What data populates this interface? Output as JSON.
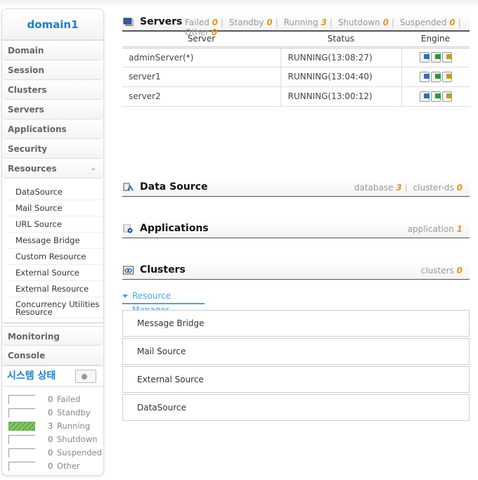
{
  "sidebar": {
    "domain": "domain1",
    "nav": [
      "Domain",
      "Session",
      "Clusters",
      "Servers",
      "Applications",
      "Security",
      "Resources"
    ],
    "resources_sub": [
      "DataSource",
      "Mail Source",
      "URL Source",
      "Message Bridge",
      "Custom Resource",
      "External Source",
      "External Resource",
      "Concurrency Utilities Resource"
    ],
    "nav_bottom": [
      "Monitoring",
      "Console"
    ],
    "system_status": {
      "title": "시스템 상태",
      "rows": [
        {
          "count": "0",
          "label": "Failed",
          "active": false
        },
        {
          "count": "0",
          "label": "Standby",
          "active": false
        },
        {
          "count": "3",
          "label": "Running",
          "active": true
        },
        {
          "count": "0",
          "label": "Shutdown",
          "active": false
        },
        {
          "count": "0",
          "label": "Suspended",
          "active": false
        },
        {
          "count": "0",
          "label": "Other",
          "active": false
        }
      ]
    }
  },
  "servers": {
    "title": "Servers",
    "counts": [
      {
        "label": "Failed",
        "value": "0"
      },
      {
        "label": "Standby",
        "value": "0"
      },
      {
        "label": "Running",
        "value": "3"
      },
      {
        "label": "Shutdown",
        "value": "0"
      },
      {
        "label": "Suspended",
        "value": "0"
      },
      {
        "label": "Other",
        "value": "0"
      }
    ],
    "columns": [
      "Server",
      "Status",
      "Engine"
    ],
    "rows": [
      {
        "server": "adminServer(*)",
        "status": "RUNNING(13:08:27)"
      },
      {
        "server": "server1",
        "status": "RUNNING(13:04:40)"
      },
      {
        "server": "server2",
        "status": "RUNNING(13:00:12)"
      }
    ],
    "engine_icons": [
      "web-engine-icon",
      "jsp-engine-icon",
      "ejb-engine-icon"
    ]
  },
  "datasource": {
    "title": "Data Source",
    "counts": [
      {
        "label": "database",
        "value": "3"
      },
      {
        "label": "cluster-ds",
        "value": "0"
      }
    ]
  },
  "applications": {
    "title": "Applications",
    "counts": [
      {
        "label": "application",
        "value": "1"
      }
    ]
  },
  "clusters": {
    "title": "Clusters",
    "counts": [
      {
        "label": "clusters",
        "value": "0"
      }
    ]
  },
  "resource_manager": {
    "tab": "Resource Manager",
    "items": [
      "Message Bridge",
      "Mail Source",
      "External Source",
      "DataSource"
    ]
  },
  "colors": {
    "accent": "#1e7fce",
    "count": "#e8961e",
    "running": "#6ab04c",
    "tab": "#4ba3e0"
  }
}
